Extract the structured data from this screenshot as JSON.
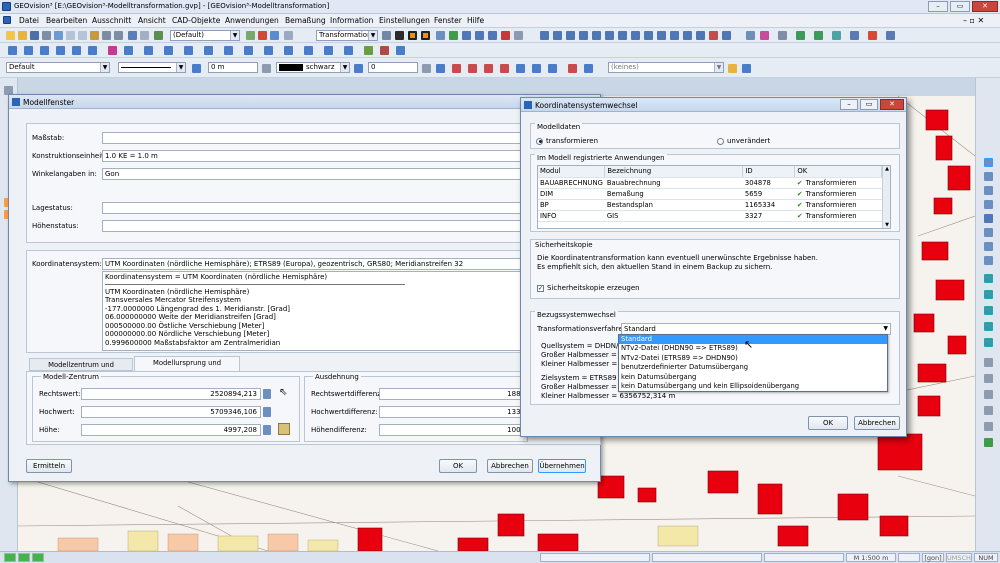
{
  "window": {
    "title": "GEOvision³  [E:\\GEOvision³-Modelltransformation.gvp] - [GEOvision³-Modelltransformation]"
  },
  "menu": [
    "Datei",
    "Bearbeiten",
    "Ausschnitt",
    "Ansicht",
    "CAD-Objekte",
    "Anwendungen",
    "Bemaßung",
    "Information",
    "Einstellungen",
    "Fenster",
    "Hilfe"
  ],
  "toolbar": {
    "default_combo": "(Default)",
    "transformation_combo": "Transformation"
  },
  "toolbar3": {
    "style": "Default",
    "offset": "0 m",
    "color": "schwarz",
    "value": "0",
    "keines": "(keines)"
  },
  "modell": {
    "title": "Modellfenster",
    "labels": {
      "massstab": "Maßstab:",
      "konstruktion": "Konstruktionseinheit:",
      "winkel": "Winkelangaben in:",
      "lage": "Lagestatus:",
      "hoehen": "Höhenstatus:",
      "koord": "Koordinatensystem:"
    },
    "values": {
      "massstab": "",
      "konstruktion": "1.0 KE  =  1.0 m",
      "winkel": "Gon",
      "lage": "",
      "hoehen": ""
    },
    "koord_value": "UTM Koordinaten (nördliche Hemisphäre); ETRS89 (Europa), geozentrisch, GRS80; Meridianstreifen 32",
    "koord_detail": [
      "Koordinatensystem = UTM Koordinaten (nördliche Hemisphäre)",
      "",
      "UTM Koordinaten (nördliche Hemisphäre)",
      "Transversales Mercator Streifensystem",
      "-177.0000000 Längengrad des 1. Meridianstr. [Grad]",
      "06.000000000 Weite der Meridianstreifen [Grad]",
      "000500000.00 Östliche Verschiebung [Meter]",
      "000000000.00 Nördliche Verschiebung [Meter]",
      "0.999600000 Maßstabsfaktor am Zentralmeridian"
    ],
    "tabs": [
      "Modellzentrum und Ausdehnung",
      "Modellursprung und Ausdehnung"
    ],
    "zentrum": {
      "title": "Modell-Zentrum",
      "rechts_l": "Rechtswert:",
      "rechts": "2520894,213",
      "hoch_l": "Hochwert:",
      "hoch": "5709346,106",
      "hoehe_l": "Höhe:",
      "hoehe": "4997,208"
    },
    "ausdehnung": {
      "title": "Ausdehnung",
      "rd_l": "Rechtswertdifferenz:",
      "rd": "1882",
      "hd_l": "Hochwertdifferenz:",
      "hd": "1339",
      "hh_l": "Höhendifferenz:",
      "hh": "1000"
    },
    "buttons": {
      "ermitteln": "Ermitteln",
      "ok": "OK",
      "abbrechen": "Abbrechen",
      "uebernehmen": "Übernehmen"
    }
  },
  "kw": {
    "title": "Koordinatensystemwechsel",
    "modelldaten": "Modelldaten",
    "radio1": "transformieren",
    "radio2": "unverändert",
    "registered": "Im Modell registrierte Anwendungen",
    "cols": [
      "Modul",
      "Bezeichnung",
      "ID",
      "OK"
    ],
    "rows": [
      {
        "modul": "BAUABRECHNUNG",
        "bez": "Bauabrechnung",
        "id": "304878",
        "ok": "Transformieren"
      },
      {
        "modul": "DIM",
        "bez": "Bemaßung",
        "id": "5659",
        "ok": "Transformieren"
      },
      {
        "modul": "BP",
        "bez": "Bestandsplan",
        "id": "1165334",
        "ok": "Transformieren"
      },
      {
        "modul": "INFO",
        "bez": "GIS",
        "id": "3327",
        "ok": "Transformieren"
      }
    ],
    "sicher_title": "Sicherheitskopie",
    "sicher_text1": "Die Koordinatentransformation kann eventuell unerwünschte Ergebnisse haben.",
    "sicher_text2": "Es empfiehlt sich, den aktuellen Stand in einem Backup zu sichern.",
    "sicher_chk": "Sicherheitskopie erzeugen",
    "bezug_title": "Bezugssystemwechsel",
    "verfahren_l": "Transformationsverfahren:",
    "verfahren": "Standard",
    "quell": [
      "Quellsystem = DHDN/PD (I",
      "Großer Halbmesser = 637",
      "Kleiner Halbmesser = 635"
    ],
    "ziel": [
      "Zielsystem = ETRS89 (Eur",
      "Großer Halbmesser = 637",
      "Kleiner Halbmesser = 6356752,314 m"
    ],
    "options": [
      "Standard",
      "NTv2-Datei (DHDN90 => ETRS89)",
      "NTv2-Datei (ETRS89 => DHDN90)",
      "benutzerdefinierter Datumsübergang",
      "kein Datumsübergang",
      "kein Datumsübergang und kein Ellipsoidenübergang"
    ],
    "ok": "OK",
    "abbrechen": "Abbrechen"
  },
  "status": {
    "scale": "M 1:500  m",
    "gon": "[gon]",
    "umsch": "UMSCH",
    "num": "NUM"
  },
  "colors": {
    "accent": "#3399ff",
    "building": "#e8000f"
  }
}
